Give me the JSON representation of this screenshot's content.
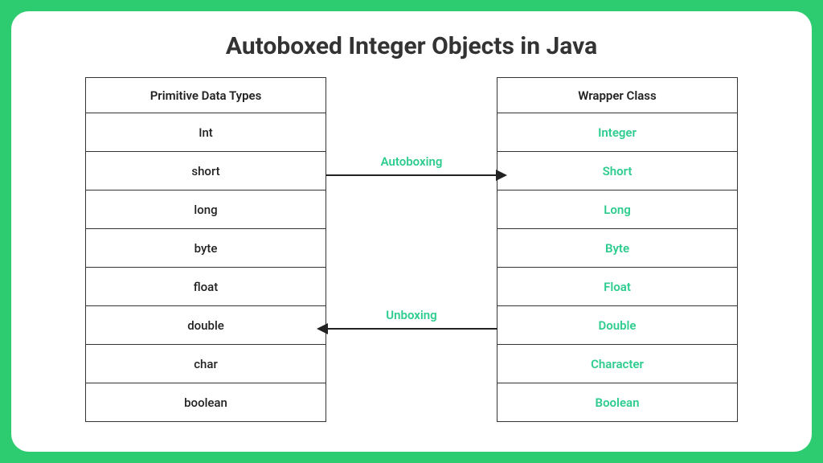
{
  "title": "Autoboxed Integer Objects in Java",
  "labels": {
    "autoboxing": "Autoboxing",
    "unboxing": "Unboxing"
  },
  "left_table": {
    "header": "Primitive Data Types",
    "rows": [
      "Int",
      "short",
      "long",
      "byte",
      "float",
      "double",
      "char",
      "boolean"
    ]
  },
  "right_table": {
    "header": "Wrapper Class",
    "rows": [
      "Integer",
      "Short",
      "Long",
      "Byte",
      "Float",
      "Double",
      "Character",
      "Boolean"
    ]
  }
}
